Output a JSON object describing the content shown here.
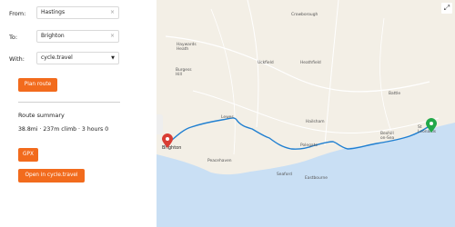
{
  "form": {
    "from_label": "From:",
    "from_value": "Hastings",
    "to_label": "To:",
    "to_value": "Brighton",
    "with_label": "With:",
    "with_value": "cycle.travel",
    "clear_glyph": "×",
    "dropdown_glyph": "▼",
    "plan_button": "Plan route"
  },
  "summary": {
    "title": "Route summary",
    "stats": "38.8mi · 237m climb · 3 hours 0",
    "gpx_button": "GPX",
    "open_button": "Open in cycle.travel"
  },
  "map": {
    "places": {
      "crowborough": "Crowborough",
      "haywards_heath": "Haywards\nHeath",
      "uckfield": "Uckfield",
      "heathfield": "Heathfield",
      "burgess_hill": "Burgess\nHill",
      "battle": "Battle",
      "lewes": "Lewes",
      "hailsham": "Hailsham",
      "bexhill": "Bexhill\non-Sea",
      "st_leonards": "St\nLeonards",
      "peacehaven": "Peacehaven",
      "seaford": "Seaford",
      "eastbourne": "Eastbourne",
      "polegate": "Polegate",
      "brighton": "Brighton"
    },
    "expand_glyph": "⤢",
    "colors": {
      "land": "#f3efe6",
      "sea": "#c9dff4",
      "route": "#1f7fd1",
      "start_marker": "#22a84a",
      "end_marker": "#d93d34",
      "accent": "#f26b1d"
    }
  }
}
